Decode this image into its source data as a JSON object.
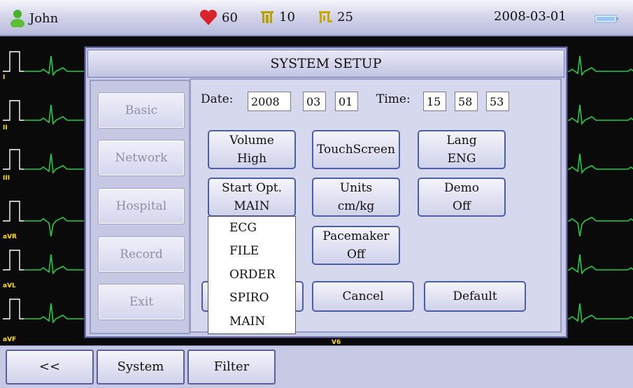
{
  "status_bar": {
    "user_name": "John",
    "heart_rate": "60",
    "resp_value": "10",
    "spo_value": "25",
    "date": "2008-03-01"
  },
  "ecg": {
    "leads": [
      "I",
      "II",
      "III",
      "aVR",
      "aVL",
      "aVF"
    ],
    "lead_v6": "V6"
  },
  "dialog": {
    "title": "SYSTEM SETUP",
    "nav": [
      "Basic",
      "Network",
      "Hospital",
      "Record",
      "Exit"
    ],
    "date_label": "Date:",
    "date_year": "2008",
    "date_month": "03",
    "date_day": "01",
    "time_label": "Time:",
    "time_hour": "15",
    "time_min": "58",
    "time_sec": "53",
    "volume": {
      "line1": "Volume",
      "line2": "High"
    },
    "touchscreen": "TouchScreen",
    "lang": {
      "line1": "Lang",
      "line2": "ENG"
    },
    "start_opt": {
      "line1": "Start Opt.",
      "line2": "MAIN"
    },
    "units": {
      "line1": "Units",
      "line2": "cm/kg"
    },
    "demo": {
      "line1": "Demo",
      "line2": "Off"
    },
    "pacemaker": {
      "line1": "Pacemaker",
      "line2": "Off"
    },
    "cancel": "Cancel",
    "default": "Default",
    "start_opt_options": [
      "ECG",
      "FILE",
      "ORDER",
      "SPIRO",
      "MAIN"
    ]
  },
  "bottom_bar": {
    "back": "<<",
    "system": "System",
    "filter": "Filter"
  },
  "colors": {
    "ecg_trace": "#22cc44",
    "lead_label": "#ffe000",
    "button_border": "#4a5fa8",
    "heart": "#d8232a"
  }
}
